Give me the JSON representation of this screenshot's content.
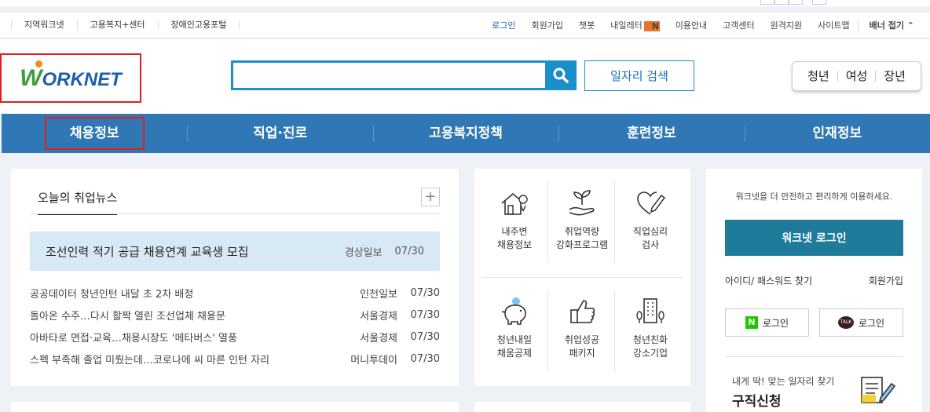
{
  "util": {
    "left_links": [
      "지역워크넷",
      "고용복지+센터",
      "장애인고용포털"
    ],
    "login": "로그인",
    "signup": "회원가입",
    "chatbot": "챗봇",
    "naeil_letter": "내일레터",
    "naeil_badge": "N",
    "usage": "이용안내",
    "customer_center": "고객센터",
    "remote_support": "원격지원",
    "sitemap": "사이트맵",
    "banner_toggle": "배너 접기"
  },
  "header": {
    "logo_text": "ORKNET",
    "logo_w": "W",
    "search_placeholder": "",
    "job_search_button": "일자리 검색",
    "target_tabs": [
      "청년",
      "여성",
      "장년"
    ]
  },
  "gnb": {
    "items": [
      "채용정보",
      "직업·진로",
      "고용복지정책",
      "훈련정보",
      "인재정보"
    ]
  },
  "news": {
    "title": "오늘의 취업뉴스",
    "more": "+",
    "headline": {
      "title": "조선인력 적기 공급 채용연계 교육생 모집",
      "source": "경상일보",
      "date": "07/30"
    },
    "items": [
      {
        "title": "공공데이터 청년인턴 내달 초 2차 배정",
        "source": "인천일보",
        "date": "07/30"
      },
      {
        "title": "돌아온 수주…다시 활짝 열린 조선업체 채용문",
        "source": "서울경제",
        "date": "07/30"
      },
      {
        "title": "아바타로 면접·교육…채용시장도 '메타버스' 열풍",
        "source": "서울경제",
        "date": "07/30"
      },
      {
        "title": "스펙 부족해 졸업 미뤘는데…코로나에 씨 마른 인턴 자리",
        "source": "머니투데이",
        "date": "07/30"
      }
    ]
  },
  "services": [
    {
      "line1": "내주변",
      "line2": "채용정보",
      "icon": "house-location-icon"
    },
    {
      "line1": "취업역량",
      "line2": "강화프로그램",
      "icon": "sprout-hand-icon"
    },
    {
      "line1": "직업심리",
      "line2": "검사",
      "icon": "heart-pen-icon"
    },
    {
      "line1": "청년내일",
      "line2": "채움공제",
      "icon": "piggy-bank-icon"
    },
    {
      "line1": "취업성공",
      "line2": "패키지",
      "icon": "thumbs-up-icon"
    },
    {
      "line1": "청년친화",
      "line2": "강소기업",
      "icon": "building-icon"
    }
  ],
  "login_panel": {
    "message": "워크넷을 더 안전하고 편리하게 이용하세요.",
    "login_button": "워크넷 로그인",
    "find_account": "아이디/ 패스워드 찾기",
    "signup": "회원가입",
    "naver_login": "로그인",
    "naver_badge": "N",
    "kakao_login": "로그인",
    "kakao_badge": "TALK",
    "sub_text": "내게 딱! 맞는 일자리 찾기",
    "big_text": "구직신청"
  }
}
